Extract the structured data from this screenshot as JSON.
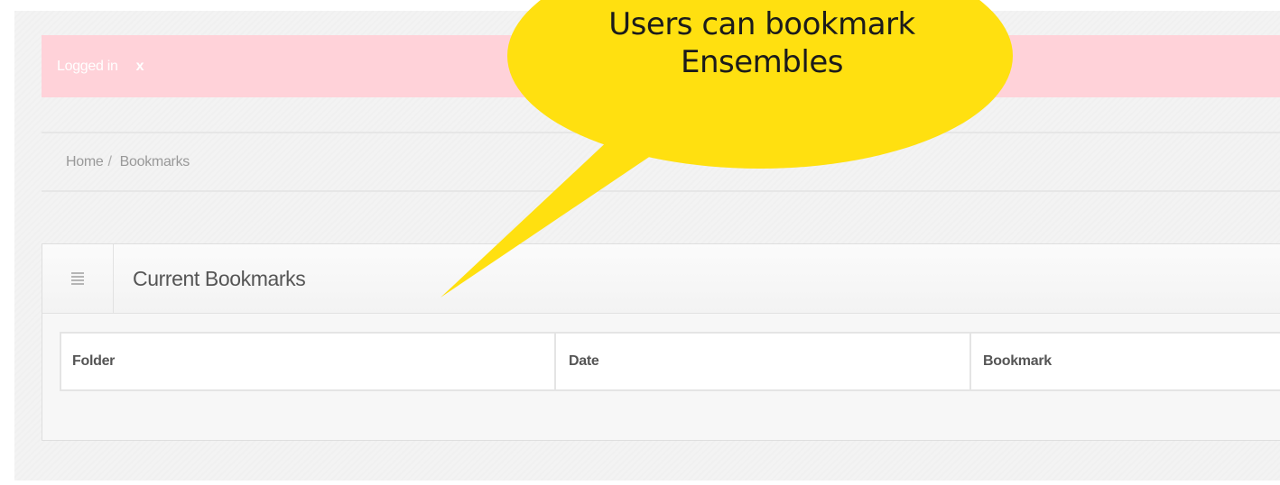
{
  "alert": {
    "message": "Logged in",
    "close_glyph": "x",
    "background": "#ffd2d9"
  },
  "breadcrumb": {
    "home": "Home",
    "separator": "/",
    "current": "Bookmarks"
  },
  "widget": {
    "icon": "list-icon",
    "title": "Current Bookmarks"
  },
  "table": {
    "columns": [
      "Folder",
      "Date",
      "Bookmark"
    ]
  },
  "callout": {
    "line1": "Users can bookmark",
    "line2": "Ensembles",
    "color": "#ffe010"
  }
}
